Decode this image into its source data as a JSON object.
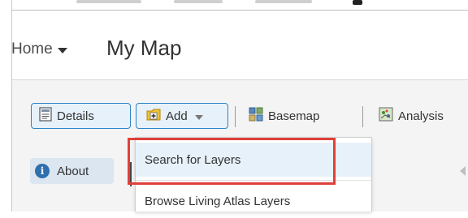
{
  "header": {
    "home_label": "Home",
    "map_title": "My Map"
  },
  "toolbar": {
    "details_label": "Details",
    "add_label": "Add",
    "basemap_label": "Basemap",
    "analysis_label": "Analysis"
  },
  "side": {
    "about_label": "About"
  },
  "add_menu": {
    "items": [
      {
        "label": "Search for Layers",
        "highlighted": true
      },
      {
        "label": "Browse Living Atlas Layers",
        "highlighted": false
      }
    ]
  },
  "colors": {
    "accent_blue": "#2b85c8",
    "highlight": "#e0403a"
  }
}
